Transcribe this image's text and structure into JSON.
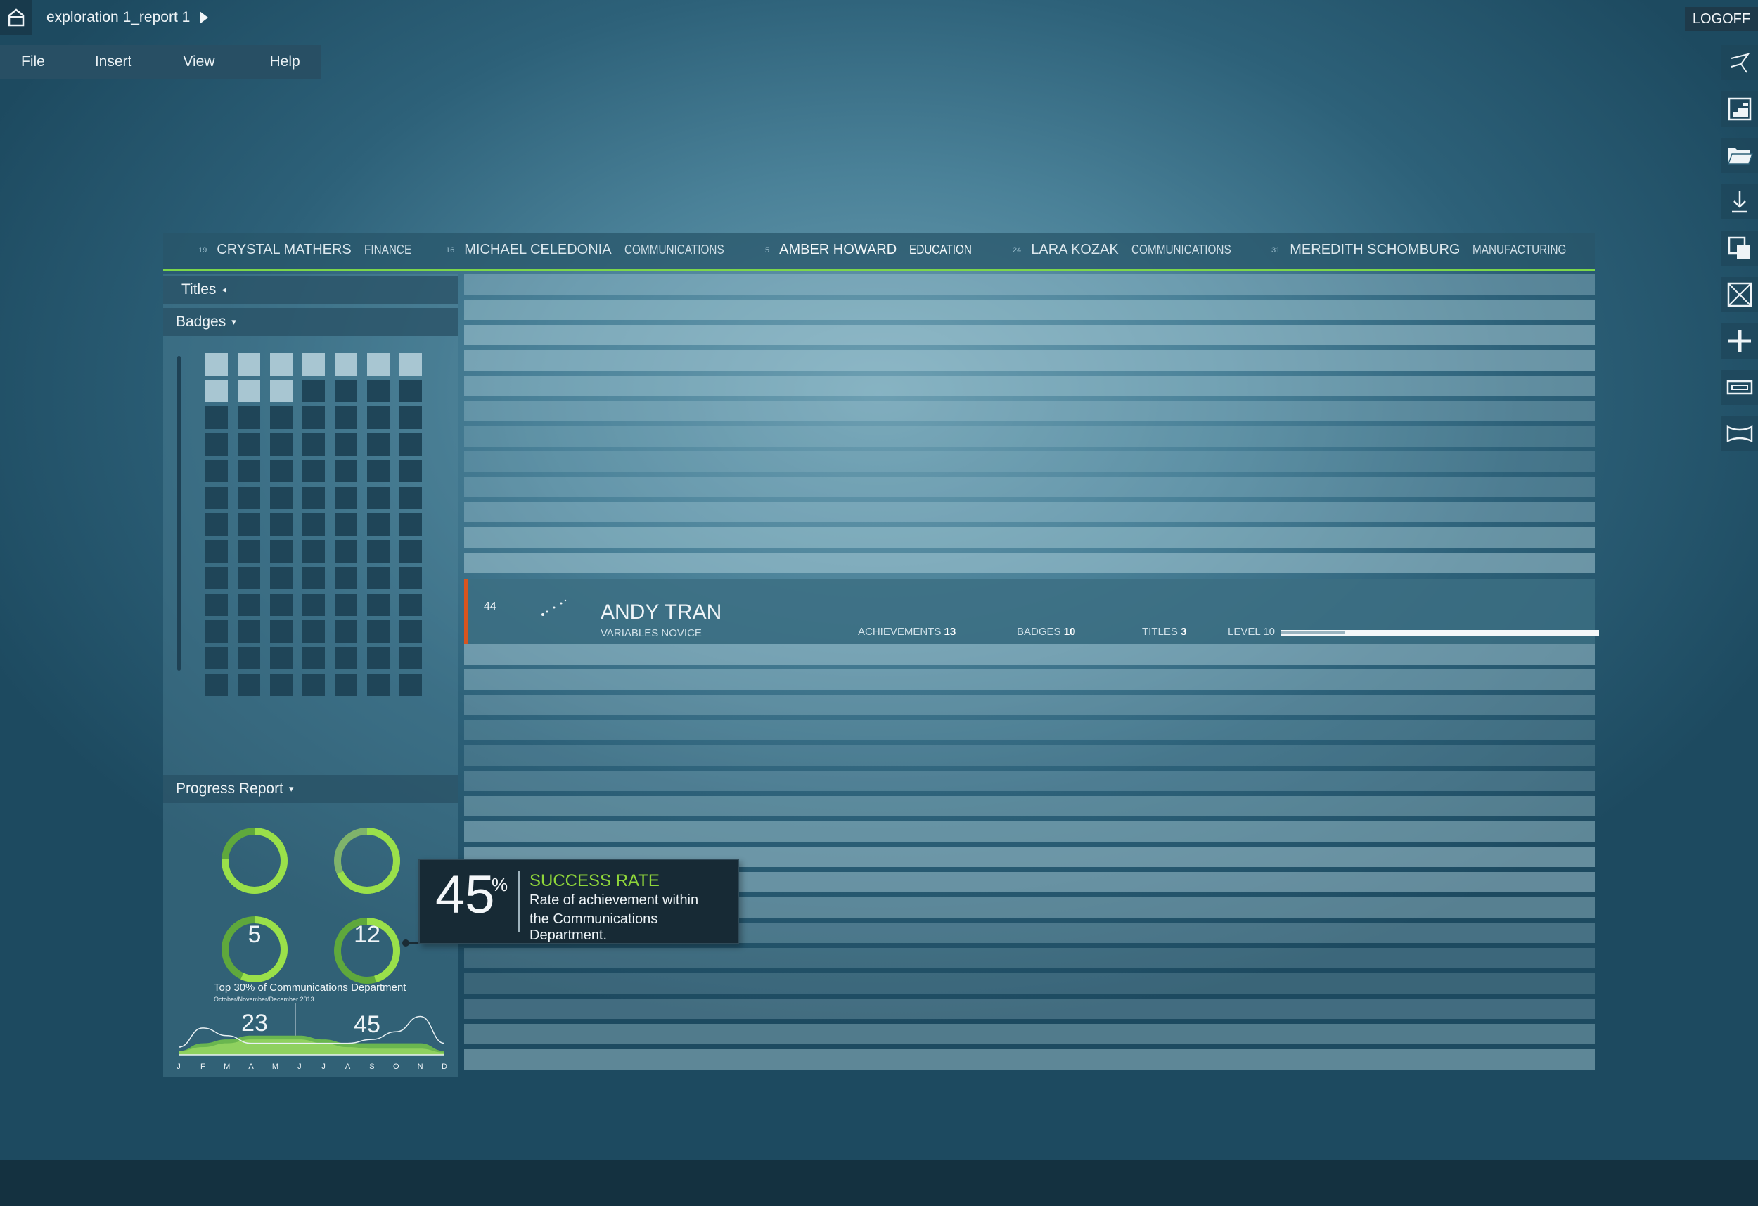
{
  "titlebar": {
    "breadcrumb": "exploration 1_report 1",
    "logoff_label": "LOGOFF"
  },
  "menu": {
    "items": [
      "File",
      "Insert",
      "View",
      "Help"
    ]
  },
  "right_toolbar": {
    "icons": [
      "share-path-icon",
      "dashboard-layout-icon",
      "open-folder-icon",
      "download-icon",
      "copy-window-icon",
      "fullscreen-icon",
      "add-icon",
      "window-icon",
      "expand-icon"
    ]
  },
  "people": [
    {
      "rank": "19",
      "name": "CRYSTAL MATHERS",
      "dept": "FINANCE"
    },
    {
      "rank": "16",
      "name": "MICHAEL CELEDONIA",
      "dept": "COMMUNICATIONS"
    },
    {
      "rank": "5",
      "name": "AMBER HOWARD",
      "dept": "EDUCATION"
    },
    {
      "rank": "24",
      "name": "LARA KOZAK",
      "dept": "COMMUNICATIONS"
    },
    {
      "rank": "31",
      "name": "MEREDITH SCHOMBURG",
      "dept": "MANUFACTURING"
    }
  ],
  "sidebar": {
    "titles_label": "Titles",
    "badges_label": "Badges",
    "progress_label": "Progress Report"
  },
  "badges": {
    "earned": 10,
    "total": 91
  },
  "progress": {
    "rings": [
      "5",
      "12",
      "23",
      "45"
    ]
  },
  "tooltip": {
    "value": "45",
    "unit": "%",
    "title": "SUCCESS RATE",
    "line1": "Rate of achievement within",
    "line2": "the Communications Department."
  },
  "featured": {
    "rank": "44",
    "name": "ANDY TRAN",
    "subtitle": "VARIABLES NOVICE",
    "achievements_label": "ACHIEVEMENTS",
    "achievements": "13",
    "badges_label": "BADGES",
    "badges": "10",
    "titles_label": "TITLES",
    "titles": "3",
    "level_label": "LEVEL 10",
    "level_progress": 0.2
  },
  "chart_data": {
    "type": "area",
    "title": "Top 30% of Communications Department",
    "subtitle": "October/November/December 2013",
    "categories": [
      "J",
      "F",
      "M",
      "A",
      "M",
      "J",
      "J",
      "A",
      "S",
      "O",
      "N",
      "D"
    ],
    "series": [
      {
        "values": [
          1,
          3.5,
          2.5,
          1.5,
          1.5,
          1.5,
          1.5,
          1.5,
          2,
          3,
          5,
          1.5
        ]
      },
      {
        "values": [
          0.5,
          1.5,
          2,
          2.5,
          2.5,
          2.5,
          2,
          1.5,
          1.5,
          1.5,
          1.5,
          0.5
        ]
      },
      {
        "values": [
          0.5,
          1,
          1.5,
          2,
          2,
          2,
          1.5,
          1,
          0.8,
          0.8,
          0.8,
          0.3
        ]
      }
    ],
    "colors": {
      "line": "#e8f0f3",
      "area1": "#7ed343",
      "area2": "#a9e36a"
    },
    "ylim": [
      0,
      5.5
    ],
    "grid": false
  },
  "colors": {
    "accent": "#7cd64a",
    "featured_border": "#d9541e",
    "tooltip_bg": "#172a35"
  }
}
